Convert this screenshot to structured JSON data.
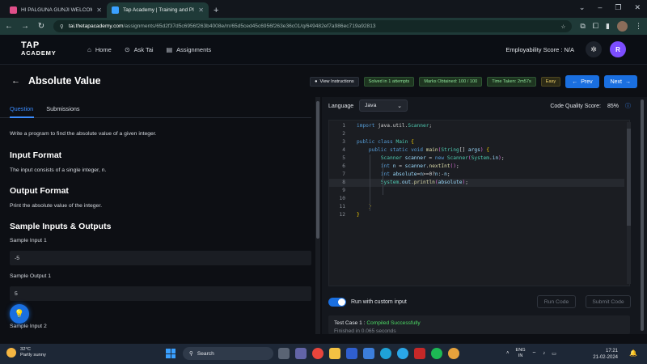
{
  "browser": {
    "tabs": [
      {
        "title": "HI PALGUNA GUNJI WELCOME",
        "active": false,
        "favicon_color": "#e04f8a"
      },
      {
        "title": "Tap Academy | Training and Pl...",
        "active": true,
        "favicon_color": "#3aa0ff"
      }
    ],
    "url_host": "tai.thetapacademy.com",
    "url_path": "/assignments/65d2f37d5c6956f263b4008e/m/65d5ced45c6956f263e36c01/q/649482ef7a986ec719a92813"
  },
  "app": {
    "logo_line1": "TAP",
    "logo_line2": "ACADEMY",
    "nav": [
      {
        "label": "Home",
        "icon": "home-icon"
      },
      {
        "label": "Ask Tai",
        "icon": "chat-icon"
      },
      {
        "label": "Assignments",
        "icon": "clipboard-icon"
      }
    ],
    "employability": "Employability Score : N/A",
    "avatar_initial": "R"
  },
  "problem": {
    "title": "Absolute Value",
    "badges": {
      "view": "View Instructions",
      "solved": "Solved in 1 attempts",
      "marks": "Marks Obtained: 100 / 100",
      "time": "Time Taken: 2m57s",
      "difficulty": "Easy"
    },
    "prev": "Prev",
    "next": "Next"
  },
  "left": {
    "tabs": [
      "Question",
      "Submissions"
    ],
    "statement": "Write a program to find the absolute value of a given integer.",
    "input_heading": "Input Format",
    "input_text": "The input consists of a single integer, n.",
    "output_heading": "Output Format",
    "output_text": "Print the absolute value of the integer.",
    "samples_heading": "Sample Inputs & Outputs",
    "sample_input_1_label": "Sample Input 1",
    "sample_input_1": "-5",
    "sample_output_1_label": "Sample Output 1",
    "sample_output_1": "5",
    "sample_input_2_label": "Sample Input 2"
  },
  "right": {
    "language_label": "Language",
    "language": "Java",
    "code_quality_label": "Code Quality Score:",
    "code_quality": "85%",
    "run_custom_label": "Run with custom input",
    "run_code": "Run Code",
    "submit_code": "Submit Code",
    "result_case": "Test Case 1 :",
    "result_status": "Compiled Successfully",
    "result_finished": "Finished in 0.065 seconds"
  },
  "code_lines": [
    "import java.util.Scanner;",
    "",
    "public class Main {",
    "    public static void main(String[] args) {",
    "        Scanner scanner = new Scanner(System.in);",
    "        int n = scanner.nextInt();",
    "        int absolute=n>=0?n:-n;",
    "        System.out.println(absolute);",
    "",
    "",
    "    }",
    "}"
  ],
  "taskbar": {
    "temperature": "32°C",
    "weather": "Partly sunny",
    "search": "Search",
    "lang_line1": "ENG",
    "lang_line2": "IN",
    "time": "17:21",
    "date": "21-02-2024"
  }
}
